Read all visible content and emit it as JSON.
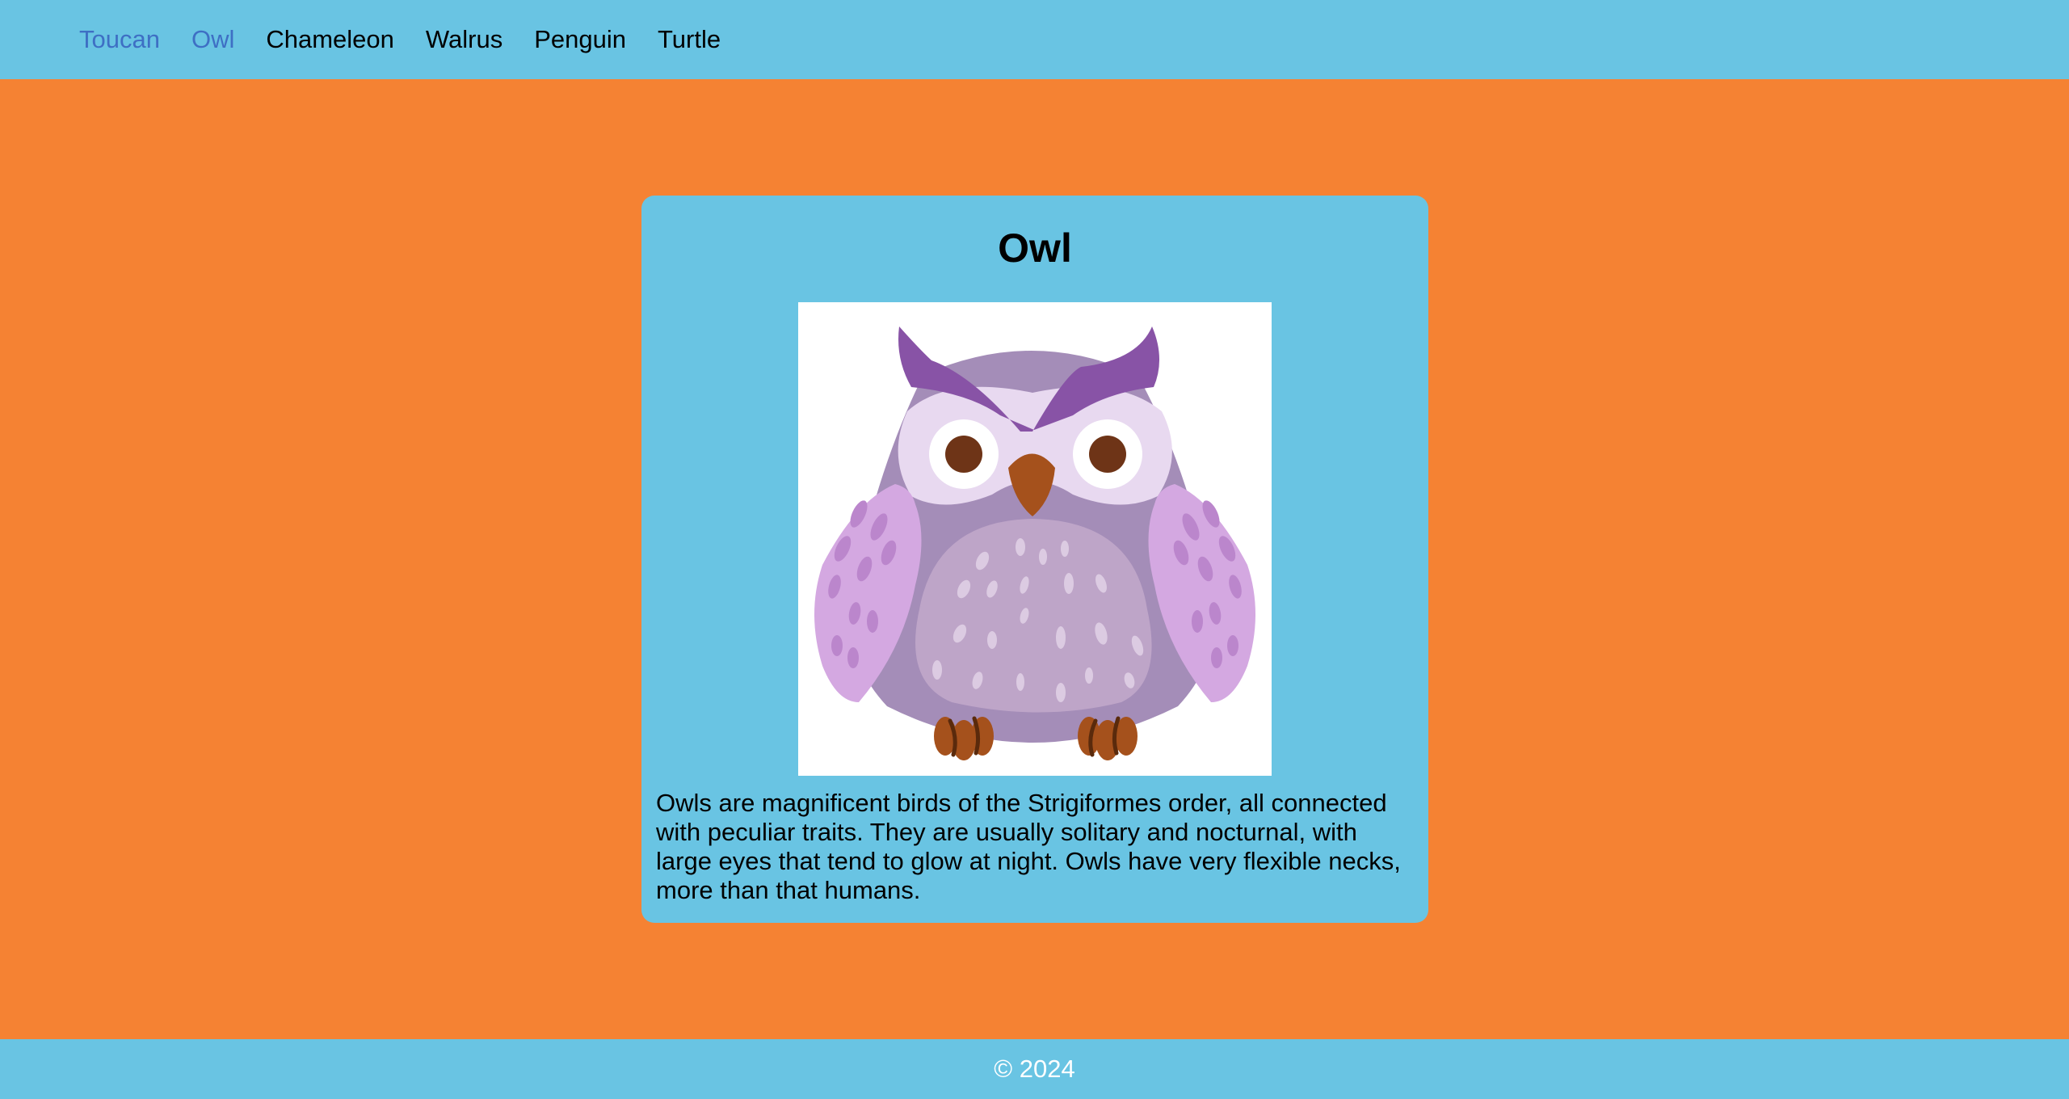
{
  "nav": {
    "items": [
      {
        "label": "Toucan",
        "visited": true
      },
      {
        "label": "Owl",
        "visited": true
      },
      {
        "label": "Chameleon",
        "visited": false
      },
      {
        "label": "Walrus",
        "visited": false
      },
      {
        "label": "Penguin",
        "visited": false
      },
      {
        "label": "Turtle",
        "visited": false
      }
    ]
  },
  "card": {
    "title": "Owl",
    "image_icon": "owl-illustration",
    "description": "Owls are magnificent birds of the Strigiformes order, all connected with peculiar traits. They are usually solitary and nocturnal, with large eyes that tend to glow at night. Owls have very flexible necks, more than that humans."
  },
  "footer": {
    "copyright": "© 2024"
  },
  "colors": {
    "page_background": "#f58233",
    "bar_background": "#69c4e3",
    "visited_link": "#3e6fc4"
  }
}
